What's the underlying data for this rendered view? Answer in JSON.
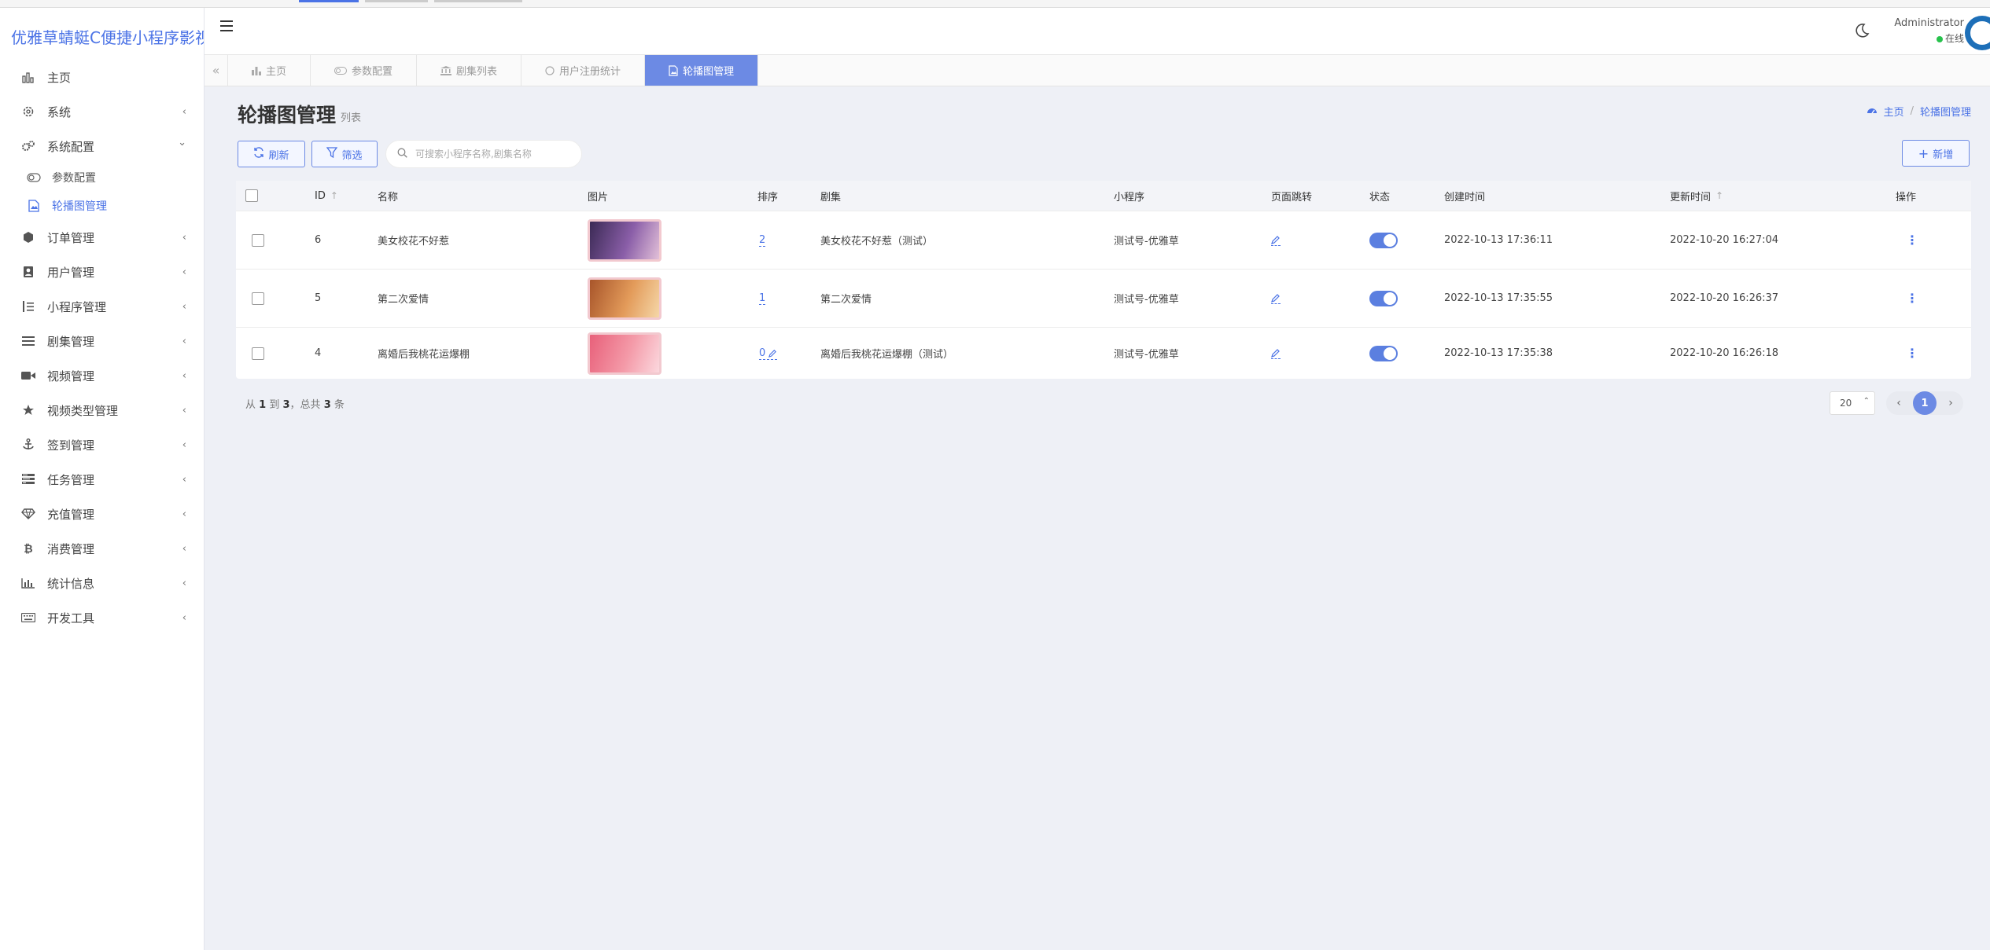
{
  "app": {
    "brand": "优雅草蜻蜓C便捷小程序影视"
  },
  "sidebar": {
    "items": [
      {
        "label": "主页",
        "icon": "bar-chart-icon",
        "arrow": ""
      },
      {
        "label": "系统",
        "icon": "gear-icon",
        "arrow": "‹"
      },
      {
        "label": "系统配置",
        "icon": "gears-icon",
        "arrow": "⌄"
      },
      {
        "label": "订单管理",
        "icon": "cube-icon",
        "arrow": "‹"
      },
      {
        "label": "用户管理",
        "icon": "user-card-icon",
        "arrow": "‹"
      },
      {
        "label": "小程序管理",
        "icon": "list-ordered-icon",
        "arrow": "‹"
      },
      {
        "label": "剧集管理",
        "icon": "list-icon",
        "arrow": "‹"
      },
      {
        "label": "视频管理",
        "icon": "video-icon",
        "arrow": "‹"
      },
      {
        "label": "视频类型管理",
        "icon": "star-icon",
        "arrow": "‹"
      },
      {
        "label": "签到管理",
        "icon": "anchor-icon",
        "arrow": "‹"
      },
      {
        "label": "任务管理",
        "icon": "tasks-icon",
        "arrow": "‹"
      },
      {
        "label": "充值管理",
        "icon": "diamond-icon",
        "arrow": "‹"
      },
      {
        "label": "消费管理",
        "icon": "bitcoin-icon",
        "arrow": "‹"
      },
      {
        "label": "统计信息",
        "icon": "stats-icon",
        "arrow": "‹"
      },
      {
        "label": "开发工具",
        "icon": "keyboard-icon",
        "arrow": "‹"
      }
    ],
    "sub_items": [
      {
        "label": "参数配置",
        "icon": "toggle-icon"
      },
      {
        "label": "轮播图管理",
        "icon": "image-icon"
      }
    ]
  },
  "header": {
    "user_name": "Administrator",
    "user_status": "在线"
  },
  "tabs": [
    {
      "label": "主页",
      "icon": "bar-chart-icon"
    },
    {
      "label": "参数配置",
      "icon": "toggle-icon"
    },
    {
      "label": "剧集列表",
      "icon": "bank-icon"
    },
    {
      "label": "用户注册统计",
      "icon": "circle-icon"
    },
    {
      "label": "轮播图管理",
      "icon": "image-icon"
    }
  ],
  "page": {
    "title": "轮播图管理",
    "subtitle": "列表",
    "breadcrumb_home": "主页",
    "breadcrumb_current": "轮播图管理",
    "refresh_label": "刷新",
    "filter_label": "筛选",
    "add_label": "新增",
    "search_placeholder": "可搜索小程序名称,剧集名称"
  },
  "table": {
    "columns": {
      "id": "ID",
      "name": "名称",
      "image": "图片",
      "sort": "排序",
      "series": "剧集",
      "miniapp": "小程序",
      "jump": "页面跳转",
      "status": "状态",
      "created": "创建时间",
      "updated": "更新时间",
      "action": "操作"
    },
    "rows": [
      {
        "id": "6",
        "name": "美女校花不好惹",
        "sort": "2",
        "series": "美女校花不好惹（测试）",
        "miniapp": "测试号-优雅草",
        "created": "2022-10-13 17:36:11",
        "updated": "2022-10-20 16:27:04",
        "thumb": [
          "#3b2a55",
          "#8a5ea8",
          "#e2c0d8"
        ]
      },
      {
        "id": "5",
        "name": "第二次爱情",
        "sort": "1",
        "series": "第二次爱情",
        "miniapp": "测试号-优雅草",
        "created": "2022-10-13 17:35:55",
        "updated": "2022-10-20 16:26:37",
        "thumb": [
          "#a8552a",
          "#e39b5a",
          "#f5d7a8"
        ]
      },
      {
        "id": "4",
        "name": "离婚后我桃花运爆棚",
        "sort": "0",
        "series": "离婚后我桃花运爆棚（测试）",
        "miniapp": "测试号-优雅草",
        "created": "2022-10-13 17:35:38",
        "updated": "2022-10-20 16:26:18",
        "thumb": [
          "#e8607a",
          "#f49aa8",
          "#fbd8de"
        ]
      }
    ]
  },
  "footer": {
    "from_label": "从",
    "from": "1",
    "to_label": "到",
    "to": "3",
    "total_label": "，总共",
    "total": "3",
    "unit": "条",
    "page_size": "20",
    "current_page": "1"
  },
  "colors": {
    "accent": "#6c8ae4",
    "link": "#4b73e6",
    "online": "#27c24c"
  }
}
